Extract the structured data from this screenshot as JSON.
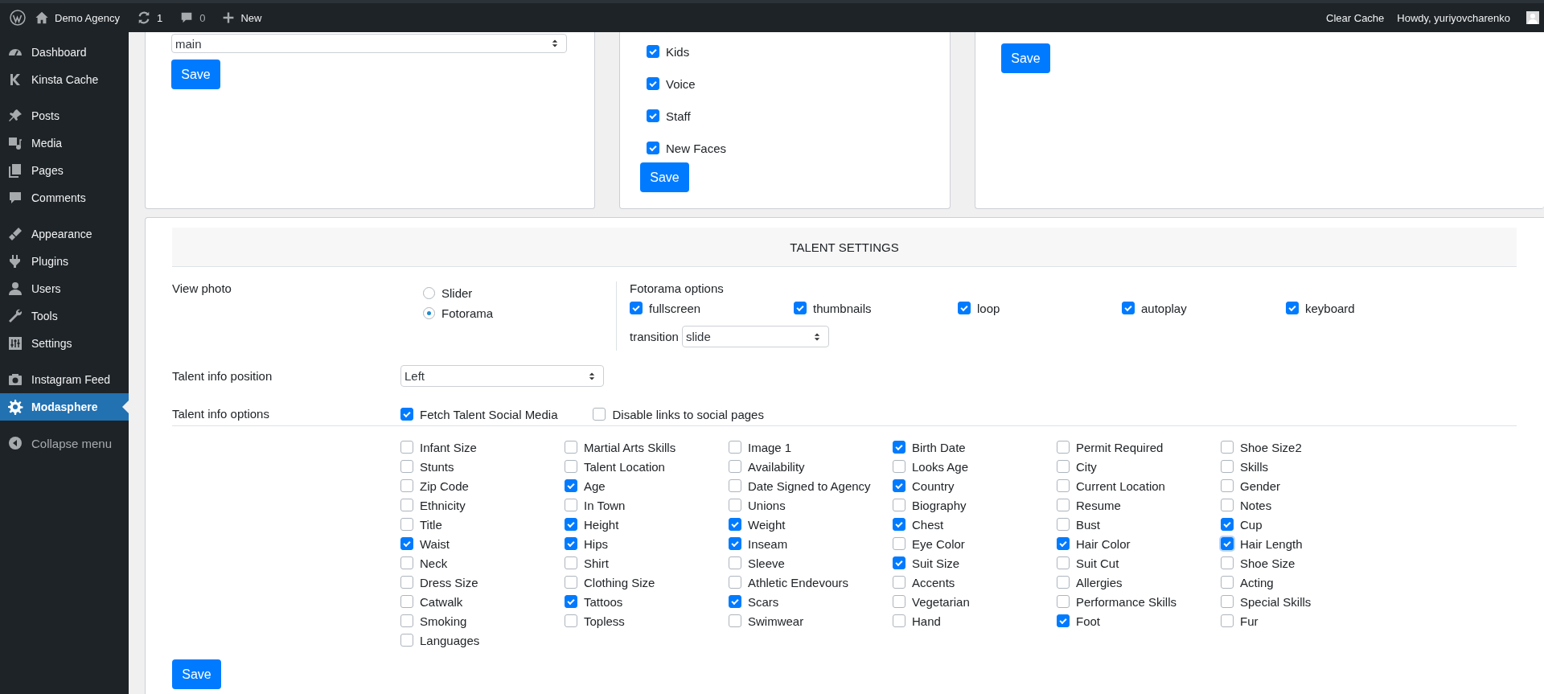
{
  "admin_bar": {
    "site": "Demo Agency",
    "updates": "1",
    "comments": "0",
    "new_label": "New",
    "clear_cache": "Clear Cache",
    "greeting": "Howdy, yuriyovcharenko"
  },
  "sidebar": {
    "groups": [
      {
        "items": [
          {
            "label": "Dashboard",
            "selected": false
          },
          {
            "label": "Kinsta Cache",
            "selected": false
          }
        ]
      },
      {
        "items": [
          {
            "label": "Posts",
            "selected": false
          },
          {
            "label": "Media",
            "selected": false
          },
          {
            "label": "Pages",
            "selected": false
          },
          {
            "label": "Comments",
            "selected": false
          }
        ]
      },
      {
        "items": [
          {
            "label": "Appearance",
            "selected": false
          },
          {
            "label": "Plugins",
            "selected": false
          },
          {
            "label": "Users",
            "selected": false
          },
          {
            "label": "Tools",
            "selected": false
          },
          {
            "label": "Settings",
            "selected": false
          }
        ]
      },
      {
        "items": [
          {
            "label": "Instagram Feed",
            "selected": false
          },
          {
            "label": "Modasphere",
            "selected": true
          }
        ]
      }
    ],
    "collapse_label": "Collapse menu"
  },
  "top_cards": [
    {
      "select_value": "main",
      "save": "Save"
    },
    {
      "checkboxes": [
        {
          "label": "Kids",
          "checked": true
        },
        {
          "label": "Voice",
          "checked": true
        },
        {
          "label": "Staff",
          "checked": true
        },
        {
          "label": "New Faces",
          "checked": true
        }
      ],
      "save": "Save"
    },
    {
      "save": "Save"
    }
  ],
  "talent_settings": {
    "title": "TALENT SETTINGS",
    "view_photo": {
      "label": "View photo",
      "options": [
        {
          "label": "Slider",
          "selected": false
        },
        {
          "label": "Fotorama",
          "selected": true
        }
      ],
      "fotorama_title": "Fotorama options",
      "fotorama_options": [
        {
          "label": "fullscreen",
          "checked": true
        },
        {
          "label": "thumbnails",
          "checked": true
        },
        {
          "label": "loop",
          "checked": true
        },
        {
          "label": "autoplay",
          "checked": true
        },
        {
          "label": "keyboard",
          "checked": true
        }
      ],
      "transition_label": "transition",
      "transition_value": "slide"
    },
    "info_position": {
      "label": "Talent info position",
      "value": "Left"
    },
    "info_options": {
      "label": "Talent info options",
      "options": [
        {
          "label": "Fetch Talent Social Media",
          "checked": true
        },
        {
          "label": "Disable links to social pages",
          "checked": false
        }
      ]
    },
    "fields": [
      {
        "label": "Infant Size",
        "checked": false,
        "focused": false
      },
      {
        "label": "Martial Arts Skills",
        "checked": false,
        "focused": false
      },
      {
        "label": "Image 1",
        "checked": false,
        "focused": false
      },
      {
        "label": "Birth Date",
        "checked": true,
        "focused": false
      },
      {
        "label": "Permit Required",
        "checked": false,
        "focused": false
      },
      {
        "label": "Shoe Size2",
        "checked": false,
        "focused": false
      },
      {
        "label": "Stunts",
        "checked": false,
        "focused": false
      },
      {
        "label": "Talent Location",
        "checked": false,
        "focused": false
      },
      {
        "label": "Availability",
        "checked": false,
        "focused": false
      },
      {
        "label": "Looks Age",
        "checked": false,
        "focused": false
      },
      {
        "label": "City",
        "checked": false,
        "focused": false
      },
      {
        "label": "Skills",
        "checked": false,
        "focused": false
      },
      {
        "label": "Zip Code",
        "checked": false,
        "focused": false
      },
      {
        "label": "Age",
        "checked": true,
        "focused": false
      },
      {
        "label": "Date Signed to Agency",
        "checked": false,
        "focused": false
      },
      {
        "label": "Country",
        "checked": true,
        "focused": false
      },
      {
        "label": "Current Location",
        "checked": false,
        "focused": false
      },
      {
        "label": "Gender",
        "checked": false,
        "focused": false
      },
      {
        "label": "Ethnicity",
        "checked": false,
        "focused": false
      },
      {
        "label": "In Town",
        "checked": false,
        "focused": false
      },
      {
        "label": "Unions",
        "checked": false,
        "focused": false
      },
      {
        "label": "Biography",
        "checked": false,
        "focused": false
      },
      {
        "label": "Resume",
        "checked": false,
        "focused": false
      },
      {
        "label": "Notes",
        "checked": false,
        "focused": false
      },
      {
        "label": "Title",
        "checked": false,
        "focused": false
      },
      {
        "label": "Height",
        "checked": true,
        "focused": false
      },
      {
        "label": "Weight",
        "checked": true,
        "focused": false
      },
      {
        "label": "Chest",
        "checked": true,
        "focused": false
      },
      {
        "label": "Bust",
        "checked": false,
        "focused": false
      },
      {
        "label": "Cup",
        "checked": true,
        "focused": false
      },
      {
        "label": "Waist",
        "checked": true,
        "focused": false
      },
      {
        "label": "Hips",
        "checked": true,
        "focused": false
      },
      {
        "label": "Inseam",
        "checked": true,
        "focused": false
      },
      {
        "label": "Eye Color",
        "checked": false,
        "focused": false
      },
      {
        "label": "Hair Color",
        "checked": true,
        "focused": false
      },
      {
        "label": "Hair Length",
        "checked": true,
        "focused": true
      },
      {
        "label": "Neck",
        "checked": false,
        "focused": false
      },
      {
        "label": "Shirt",
        "checked": false,
        "focused": false
      },
      {
        "label": "Sleeve",
        "checked": false,
        "focused": false
      },
      {
        "label": "Suit Size",
        "checked": true,
        "focused": false
      },
      {
        "label": "Suit Cut",
        "checked": false,
        "focused": false
      },
      {
        "label": "Shoe Size",
        "checked": false,
        "focused": false
      },
      {
        "label": "Dress Size",
        "checked": false,
        "focused": false
      },
      {
        "label": "Clothing Size",
        "checked": false,
        "focused": false
      },
      {
        "label": "Athletic Endevours",
        "checked": false,
        "focused": false
      },
      {
        "label": "Accents",
        "checked": false,
        "focused": false
      },
      {
        "label": "Allergies",
        "checked": false,
        "focused": false
      },
      {
        "label": "Acting",
        "checked": false,
        "focused": false
      },
      {
        "label": "Catwalk",
        "checked": false,
        "focused": false
      },
      {
        "label": "Tattoos",
        "checked": true,
        "focused": false
      },
      {
        "label": "Scars",
        "checked": true,
        "focused": false
      },
      {
        "label": "Vegetarian",
        "checked": false,
        "focused": false
      },
      {
        "label": "Performance Skills",
        "checked": false,
        "focused": false
      },
      {
        "label": "Special Skills",
        "checked": false,
        "focused": false
      },
      {
        "label": "Smoking",
        "checked": false,
        "focused": false
      },
      {
        "label": "Topless",
        "checked": false,
        "focused": false
      },
      {
        "label": "Swimwear",
        "checked": false,
        "focused": false
      },
      {
        "label": "Hand",
        "checked": false,
        "focused": false
      },
      {
        "label": "Foot",
        "checked": true,
        "focused": false
      },
      {
        "label": "Fur",
        "checked": false,
        "focused": false
      },
      {
        "label": "Languages",
        "checked": false,
        "focused": false
      }
    ],
    "save": "Save"
  }
}
